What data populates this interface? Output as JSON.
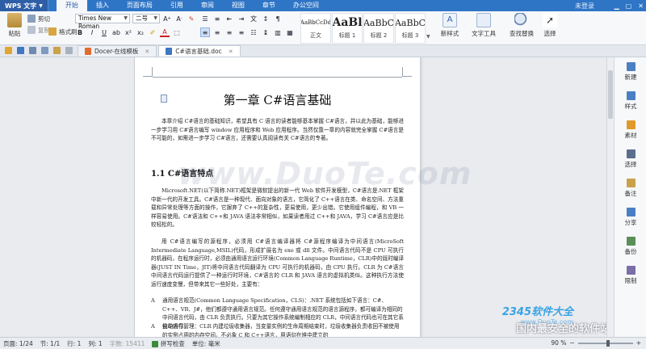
{
  "app": {
    "logo": "WPS 文字",
    "menu_tabs": [
      "开始",
      "插入",
      "页面布局",
      "引用",
      "审阅",
      "视图",
      "章节",
      "办公空间"
    ],
    "active_tab": 0,
    "login": "未登录"
  },
  "ribbon": {
    "paste": "粘贴",
    "cut": "剪切",
    "copy": "复制",
    "format_painter": "格式刷",
    "font_name": "Times New Roman",
    "font_size": "二号",
    "bold": "B",
    "italic": "I",
    "underline": "U",
    "font_color_a": "A",
    "styles": [
      {
        "preview": "AaBbCcDd",
        "name": "正文"
      },
      {
        "preview": "AaBl",
        "name": "标题 1"
      },
      {
        "preview": "AaBbC",
        "name": "标题 2"
      },
      {
        "preview": "AaBbC",
        "name": "标题 3"
      }
    ],
    "new_style": "新样式",
    "text_tools": "文字工具",
    "find_replace": "查找替换",
    "select": "选择"
  },
  "tabs": [
    {
      "label": "Docer-在线模板",
      "active": false
    },
    {
      "label": "C#语言基础.doc",
      "active": true
    }
  ],
  "document": {
    "chapter_title": "第一章  C#语言基础",
    "intro": "本章介绍 C#语言的基础知识，希望具有 C 语言的读者能够基本掌握 C#语言，并以此为基础，能够进一步学习用 C#语言编写 window 应用程序和 Web 应用程序。当然仅靠一章的内容就完全掌握 C#语言是不可能的，如需进一步学习 C#语言，还需要认真阅读有关 C#语言的专著。",
    "section_title": "1.1   C#语言特点",
    "p1": "Microsoft.NET(以下简称.NET)框架是微软提出的新一代 Web 软件开发模型，C#语言是.NET 框架中新一代的开发工具。C#语言是一种现代、面向对象的语言，它简化了 C++语言在类、命名空间、方法重载和异常处理等方面的操作，它摒弃了 C++的复杂性，更易使用，更少出错。它使用组件编程，和 VB 一样容易使用。C#语法和 C++和 JAVA 语法非常相似，如果读者用过 C++和 JAVA，学习 C#语言应是比较轻松的。",
    "p2": "用 C#语言编写的源程序，必须用 C#语言编译器将 C#源程序编译为中间语言(MicroSoft Intermediate Language,MSIL)代码，形成扩展名为 exe 或 dll 文件。中间语言代码不是 CPU 可执行的机器码，在程序运行时，必须由通用语言运行环境(Common Language Runtime，CLR)中的既时编译器(JUST IN Time，JIT)将中间语言代码翻译为 CPU 可执行的机器码，由 CPU 执行。CLR 为 C#语言中间语言代码运行提供了一种运行时环境，C#语言的 CLR 和 JAVA 语言的虚拟机类似。这种执行方法使运行速度变慢，但带来其它一些好处，主要有：",
    "b1": "通用语言规范(Common Language Specification，CLS)：.NET 系统包括如下语言：C#、C++、VB、J#，他们都遵守通用语言规范。任何遵守通用语言规范的语言源程序，都可编译为相同的中间语言代码，由 CLR 负责执行。只要为其它操作系统编制相应的 CLR，中间语言代码也可在其它系统中运行。",
    "b2": "自动内存管理：CLR 内建垃圾收集器，当变量实例的生命周期结束时，垃圾收集器负责收回不被使用的实例占用的内存空间。不必象 C 和 C++语言，用语句在堆中建立的",
    "bullet_mark": "A",
    "watermark": "www.DuoTe.com",
    "wm_brand": "2345软件大全",
    "wm_url": "www.DuoTe.com",
    "wm_slogan": "国内最安全的软件站"
  },
  "sidebar": [
    "新建",
    "样式",
    "素材",
    "选择",
    "备注",
    "分享",
    "备份",
    "限制"
  ],
  "status": {
    "page": "页面: 1/24",
    "section": "节: 1/1",
    "row": "行: 1",
    "col": "列: 1",
    "chars": "字数: 15411",
    "spell": "拼写检查",
    "unit": "单位: 毫米",
    "zoom": "90 %",
    "zoom_fraction": 0.55
  },
  "colors": {
    "titlebar": "#2f75c6",
    "accent": "#2a5ca8"
  }
}
